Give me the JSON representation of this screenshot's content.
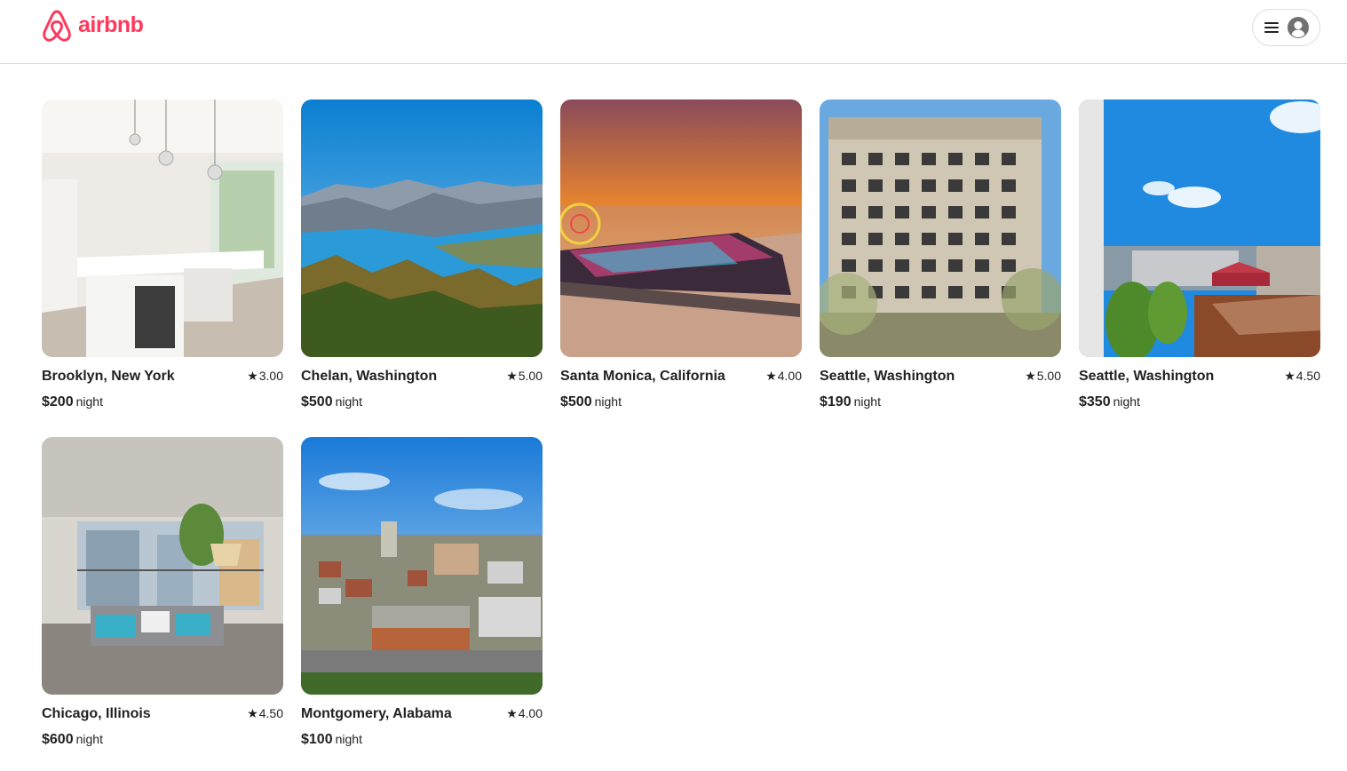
{
  "brand": {
    "name": "airbnb",
    "color": "#ff385c"
  },
  "header": {
    "menu_icon": "hamburger-icon",
    "avatar_icon": "user-avatar-icon"
  },
  "listings": [
    {
      "location": "Brooklyn, New York",
      "rating": "3.00",
      "price": "$200",
      "per": "night",
      "image": "modern-white-kitchen"
    },
    {
      "location": "Chelan, Washington",
      "rating": "5.00",
      "price": "$500",
      "per": "night",
      "image": "mountain-lake"
    },
    {
      "location": "Santa Monica, California",
      "rating": "4.00",
      "price": "$500",
      "per": "night",
      "image": "pier-sunset"
    },
    {
      "location": "Seattle, Washington",
      "rating": "5.00",
      "price": "$190",
      "per": "night",
      "image": "historic-building"
    },
    {
      "location": "Seattle, Washington",
      "rating": "4.50",
      "price": "$350",
      "per": "night",
      "image": "rooftop-garden"
    },
    {
      "location": "Chicago, Illinois",
      "rating": "4.50",
      "price": "$600",
      "per": "night",
      "image": "living-room-city-view"
    },
    {
      "location": "Montgomery, Alabama",
      "rating": "4.00",
      "price": "$100",
      "per": "night",
      "image": "city-aerial"
    }
  ]
}
